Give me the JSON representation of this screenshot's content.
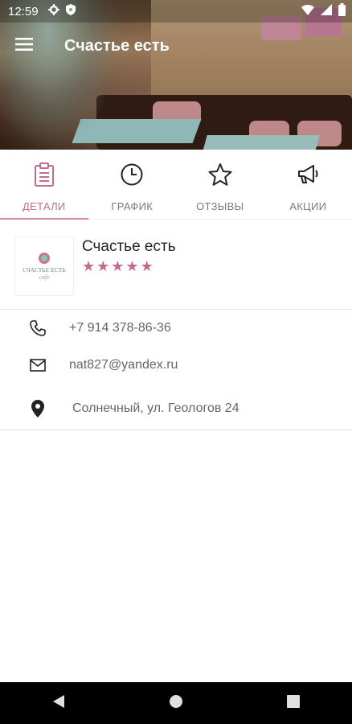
{
  "status": {
    "time": "12:59"
  },
  "appbar": {
    "title": "Счастье есть"
  },
  "tabs": [
    {
      "label": "ДЕТАЛИ",
      "active": true
    },
    {
      "label": "ГРАФИК",
      "active": false
    },
    {
      "label": "ОТЗЫВЫ",
      "active": false
    },
    {
      "label": "АКЦИИ",
      "active": false
    }
  ],
  "place": {
    "name": "Счастье есть",
    "rating": 5,
    "logo_text": "СЧАСТЬЕ ЕСТЬ",
    "logo_subtext": "cafe"
  },
  "contacts": {
    "phone": "+7 914 378-86-36",
    "email": "nat827@yandex.ru",
    "address": "Солнечный, ул. Геологов 24"
  },
  "colors": {
    "accent": "#c46d8f",
    "star": "#c06a90"
  }
}
